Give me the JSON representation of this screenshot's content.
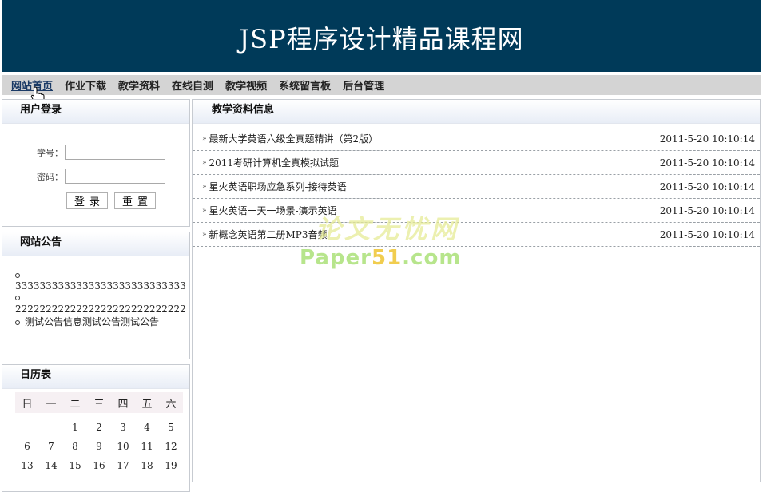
{
  "header": {
    "title": "JSP程序设计精品课程网"
  },
  "nav": {
    "items": [
      "网站首页",
      "作业下载",
      "教学资料",
      "在线自测",
      "教学视频",
      "系统留言板",
      "后台管理"
    ]
  },
  "login": {
    "title": "用户登录",
    "student_id_label": "学号：",
    "password_label": "密码：",
    "login_button": "登录",
    "reset_button": "重置"
  },
  "notice": {
    "title": "网站公告",
    "items": [
      "3333333333333333333333333333",
      "2222222222222222222222222222",
      "测试公告信息测试公告测试公告"
    ]
  },
  "calendar": {
    "title": "日历表",
    "weekdays": [
      "日",
      "一",
      "二",
      "三",
      "四",
      "五",
      "六"
    ],
    "rows": [
      [
        "",
        "",
        "1",
        "2",
        "3",
        "4",
        "5"
      ],
      [
        "6",
        "7",
        "8",
        "9",
        "10",
        "11",
        "12"
      ],
      [
        "13",
        "14",
        "15",
        "16",
        "17",
        "18",
        "19"
      ]
    ]
  },
  "main": {
    "title": "教学资料信息",
    "items": [
      {
        "name": "最新大学英语六级全真题精讲（第2版）",
        "date": "2011-5-20 10:10:14"
      },
      {
        "name": "2011考研计算机全真模拟试题",
        "date": "2011-5-20 10:10:14"
      },
      {
        "name": "星火英语职场应急系列-接待英语",
        "date": "2011-5-20 10:10:14"
      },
      {
        "name": "星火英语一天一场景-演示英语",
        "date": "2011-5-20 10:10:14"
      },
      {
        "name": "新概念英语第二册MP3音频",
        "date": "2011-5-20 10:10:14"
      }
    ]
  },
  "watermark": {
    "line1": "论文无忧网",
    "line2a": "Paper",
    "line2b": "51",
    "line2c": ".com"
  }
}
